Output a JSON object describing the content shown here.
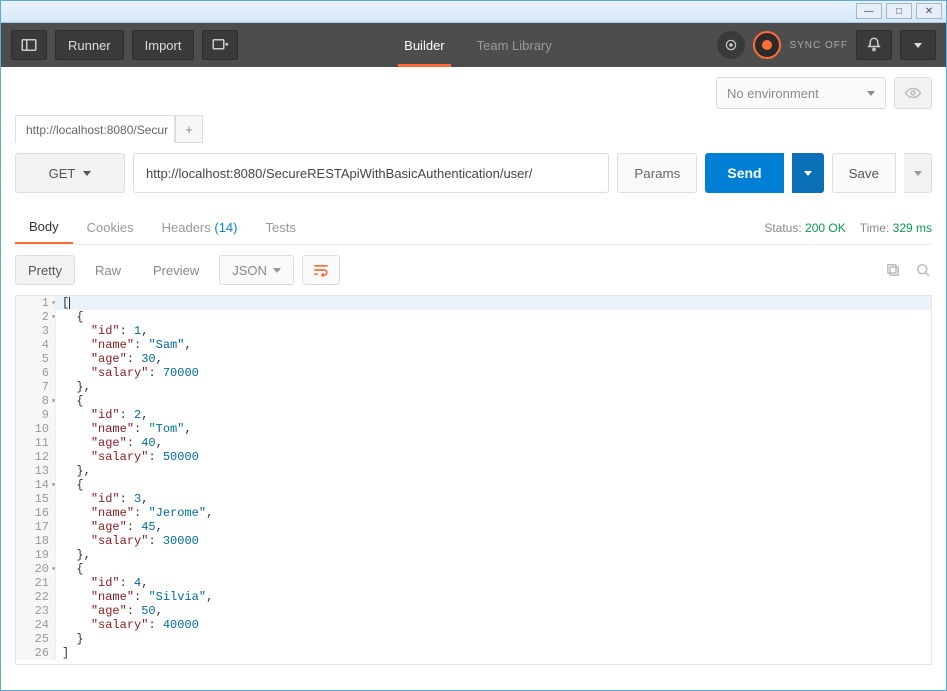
{
  "window": {
    "hint": ""
  },
  "titlebar": {
    "min": "—",
    "max": "□",
    "close": "✕"
  },
  "toolbar": {
    "runner": "Runner",
    "import": "Import",
    "builder": "Builder",
    "team_library": "Team Library",
    "sync_label": "SYNC OFF"
  },
  "environment": {
    "placeholder": "No environment"
  },
  "tabs": {
    "tab1": "http://localhost:8080/Secur",
    "add": "+"
  },
  "request": {
    "method": "GET",
    "url": "http://localhost:8080/SecureRESTApiWithBasicAuthentication/user/",
    "params": "Params",
    "send": "Send",
    "save": "Save"
  },
  "response_tabs": {
    "body": "Body",
    "cookies": "Cookies",
    "headers": "Headers",
    "headers_count": "(14)",
    "tests": "Tests"
  },
  "response_meta": {
    "status_label": "Status:",
    "status_value": "200 OK",
    "time_label": "Time:",
    "time_value": "329 ms"
  },
  "viewer": {
    "pretty": "Pretty",
    "raw": "Raw",
    "preview": "Preview",
    "format": "JSON"
  },
  "response_body": [
    {
      "id": 1,
      "name": "Sam",
      "age": 30,
      "salary": 70000
    },
    {
      "id": 2,
      "name": "Tom",
      "age": 40,
      "salary": 50000
    },
    {
      "id": 3,
      "name": "Jerome",
      "age": 45,
      "salary": 30000
    },
    {
      "id": 4,
      "name": "Silvia",
      "age": 50,
      "salary": 40000
    }
  ],
  "code_lines": {
    "l1": "[",
    "l2o": "{",
    "l7c": "},",
    "l13c": "},",
    "l19c": "},",
    "l25c": "}",
    "l26": "]",
    "k_id": "id",
    "k_name": "name",
    "k_age": "age",
    "k_salary": "salary",
    "v_id1": "1",
    "v_name1": "Sam",
    "v_age1": "30",
    "v_salary1": "70000",
    "v_id2": "2",
    "v_name2": "Tom",
    "v_age2": "40",
    "v_salary2": "50000",
    "v_id3": "3",
    "v_name3": "Jerome",
    "v_age3": "45",
    "v_salary3": "30000",
    "v_id4": "4",
    "v_name4": "Silvia",
    "v_age4": "50",
    "v_salary4": "40000"
  }
}
